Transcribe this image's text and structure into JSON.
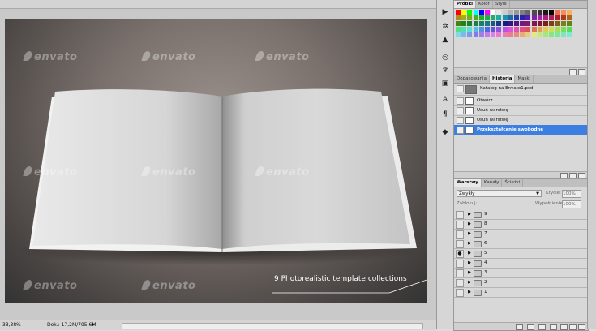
{
  "canvas": {
    "watermark": "envato",
    "callout": "9 Photorealistic template collections"
  },
  "status_bar": {
    "zoom": "33,38%",
    "doc_info": "Dok.: 17,2M/795,6M"
  },
  "swatches_panel": {
    "tabs": [
      "Próbki",
      "Kolor",
      "Style"
    ],
    "active_tab": 0
  },
  "history_panel": {
    "tabs": [
      "Dopasowania",
      "Historia",
      "Maski"
    ],
    "active_tab": 1,
    "snapshot": "Katalog na Envato1.psd",
    "steps": [
      "Otwórz",
      "Usuń warstwę",
      "Usuń warstwę",
      "Przekształcanie swobodne"
    ],
    "selected_step": 3
  },
  "layers_panel": {
    "tabs": [
      "Warstwy",
      "Kanały",
      "Ścieżki"
    ],
    "active_tab": 0,
    "blend_mode": "Zwykły",
    "opacity_label": "Krycie:",
    "opacity": "100%",
    "lock_label": "Zablokuj:",
    "fill_label": "Wypełnienie:",
    "fill": "100%",
    "layers": [
      "9",
      "8",
      "7",
      "6",
      "5",
      "4",
      "3",
      "2",
      "1"
    ],
    "visible_layer": "5"
  },
  "colors": {
    "selection": "#3d7fe0",
    "panel": "#d8d8d8"
  }
}
